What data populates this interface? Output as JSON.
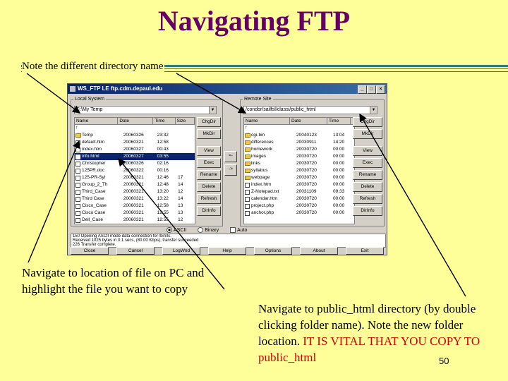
{
  "slide": {
    "title": "Navigating FTP",
    "note": "Note the different directory name",
    "caption_left": "Navigate to location of file on PC and highlight the file you want to copy",
    "caption_right_plain": "Navigate to public_html directory (by double clicking folder name). Note the new folder location. ",
    "caption_right_warning": "IT IS VITAL THAT YOU COPY TO public_html",
    "page_number": "50",
    "colors": {
      "background": "#ffff99",
      "title": "#660066",
      "rule": "#2e7d7d",
      "warning": "#cc0000"
    }
  },
  "ftp_window": {
    "title": "WS_FTP LE ftp.cdm.depaul.edu",
    "local": {
      "label": "Local System",
      "path": "C:\\My Temp",
      "columns": [
        "Name",
        "Date",
        "Time",
        "Size"
      ],
      "rows": [
        {
          "icon": "up-icon",
          "name": "",
          "date": "",
          "time": "",
          "size": ""
        },
        {
          "icon": "folder-icon",
          "name": "Temp",
          "date": "20060326",
          "time": "23:32",
          "size": ""
        },
        {
          "icon": "file-icon",
          "name": "default.htm",
          "date": "20060321",
          "time": "12:58",
          "size": ""
        },
        {
          "icon": "file-icon",
          "name": "index.htm",
          "date": "20060327",
          "time": "00:43",
          "size": ""
        },
        {
          "icon": "file-icon",
          "name": "info.html",
          "date": "20060327",
          "time": "03:55",
          "size": "",
          "selected": true
        },
        {
          "icon": "file-icon",
          "name": "Christopher",
          "date": "20060326",
          "time": "02:16",
          "size": ""
        },
        {
          "icon": "file-icon",
          "name": "125PR.doc",
          "date": "20060322",
          "time": "00:16",
          "size": ""
        },
        {
          "icon": "file-icon",
          "name": "125-PR-Syl",
          "date": "20060321",
          "time": "12:46",
          "size": "17"
        },
        {
          "icon": "file-icon",
          "name": "Group_2_Th",
          "date": "20060321",
          "time": "12:48",
          "size": "14"
        },
        {
          "icon": "file-icon",
          "name": "Third_Case",
          "date": "20060321",
          "time": "13:20",
          "size": "12"
        },
        {
          "icon": "file-icon",
          "name": "Third Case",
          "date": "20060321",
          "time": "13:22",
          "size": "14"
        },
        {
          "icon": "file-icon",
          "name": "Cisco_Case",
          "date": "20060321",
          "time": "12:58",
          "size": "13"
        },
        {
          "icon": "file-icon",
          "name": "Cisco Case",
          "date": "20060321",
          "time": "12:55",
          "size": "13"
        },
        {
          "icon": "file-icon",
          "name": "Dell_Case",
          "date": "20060321",
          "time": "12:55",
          "size": "12"
        }
      ],
      "buttons": [
        "ChgDir",
        "MkDir",
        "View",
        "Exec",
        "Rename",
        "Delete",
        "Refresh",
        "DirInfo"
      ]
    },
    "remote": {
      "label": "Remote Site",
      "path": "/condor/sailfsl/classi/public_html",
      "columns": [
        "Name",
        "Date",
        "Time"
      ],
      "rows": [
        {
          "icon": "up-icon",
          "name": "",
          "date": "",
          "time": ""
        },
        {
          "icon": "folder-icon",
          "name": "cgi-bin",
          "date": "20040123",
          "time": "13:04"
        },
        {
          "icon": "folder-icon",
          "name": "differences",
          "date": "20030911",
          "time": "14:20"
        },
        {
          "icon": "folder-icon",
          "name": "homework",
          "date": "20030720",
          "time": "00:00"
        },
        {
          "icon": "folder-icon",
          "name": "images",
          "date": "20030720",
          "time": "00:00"
        },
        {
          "icon": "folder-icon",
          "name": "links",
          "date": "20030720",
          "time": "00:00"
        },
        {
          "icon": "folder-icon",
          "name": "syllabus",
          "date": "20030720",
          "time": "00:00"
        },
        {
          "icon": "folder-icon",
          "name": "webpage",
          "date": "20030720",
          "time": "00:00"
        },
        {
          "icon": "file-icon",
          "name": "index.htm",
          "date": "20030720",
          "time": "00:00"
        },
        {
          "icon": "file-icon",
          "name": "Z-Notepad.txt",
          "date": "20031109",
          "time": "09:33"
        },
        {
          "icon": "file-icon",
          "name": "calendar.htm",
          "date": "20030720",
          "time": "00:00"
        },
        {
          "icon": "file-icon",
          "name": "project.php",
          "date": "20030720",
          "time": "00:00"
        },
        {
          "icon": "file-icon",
          "name": "anchor.php",
          "date": "20030720",
          "time": "00:00"
        }
      ],
      "buttons": [
        "ChgDir",
        "MkDir",
        "View",
        "Exec",
        "Rename",
        "Delete",
        "Refresh",
        "DirInfo"
      ]
    },
    "transfer_left": "<-",
    "transfer_right": "->",
    "mode": {
      "ascii": "ASCII",
      "binary": "Binary",
      "auto": "Auto",
      "selected": "ASCII"
    },
    "log": [
      "150 Opening ASCII mode data connection for /bin/ls.",
      "Received 1025 bytes in 0.1 secs, (80.00 Kbps), transfer succeeded",
      "226 Transfer complete."
    ],
    "bottom_buttons": [
      "Close",
      "Cancel",
      "LogWnd",
      "Help",
      "Options",
      "About",
      "Exit"
    ]
  }
}
